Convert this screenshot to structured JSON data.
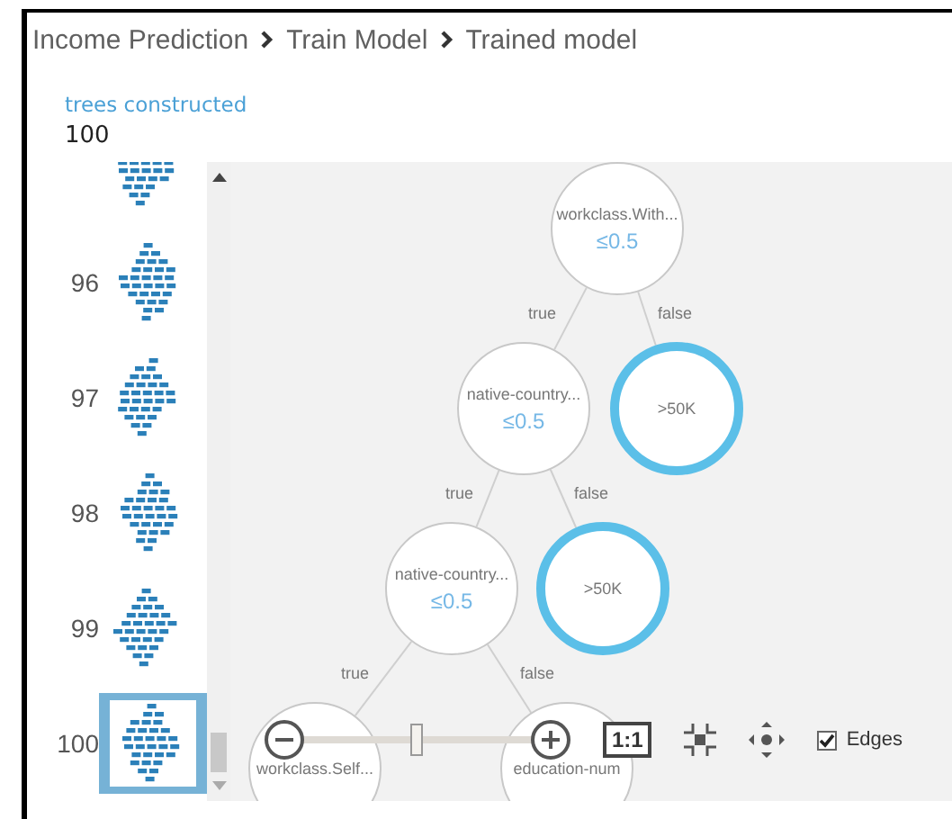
{
  "breadcrumb": [
    "Income Prediction",
    "Train Model",
    "Trained model"
  ],
  "stat": {
    "label": "trees constructed",
    "value": "100"
  },
  "trees": [
    {
      "selected": false
    },
    {
      "label": "96",
      "selected": false
    },
    {
      "label": "97",
      "selected": false
    },
    {
      "label": "98",
      "selected": false
    },
    {
      "label": "99",
      "selected": false
    },
    {
      "label": "100",
      "selected": true
    }
  ],
  "tree": {
    "kind": "split",
    "label": "workclass.With...",
    "condition": "≤0.5",
    "children": [
      {
        "kind": "split",
        "edge": "true",
        "label": "native-country...",
        "condition": "≤0.5",
        "children": [
          {
            "kind": "split",
            "edge": "true",
            "label": "native-country...",
            "condition": "≤0.5",
            "children": [
              {
                "kind": "split",
                "edge": "true",
                "label": "workclass.Self..."
              },
              {
                "kind": "split",
                "edge": "false",
                "label": "education-num"
              }
            ]
          },
          {
            "kind": "leaf",
            "edge": "false",
            "label": ">50K"
          }
        ]
      },
      {
        "kind": "leaf",
        "edge": "false",
        "label": ">50K"
      }
    ]
  },
  "toolbar": {
    "zoom": {
      "level": 0.5
    },
    "actual_size": "1:1",
    "edges": {
      "label": "Edges",
      "checked": true
    }
  }
}
